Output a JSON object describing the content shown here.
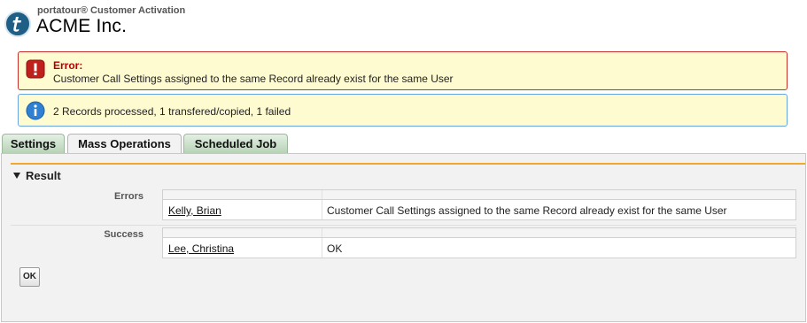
{
  "header": {
    "subtitle": "portatour® Customer Activation",
    "title": "ACME Inc."
  },
  "messages": {
    "error": {
      "title": "Error:",
      "text": "Customer Call Settings assigned to the same Record already exist for the same User"
    },
    "info": {
      "text": "2 Records processed, 1 transfered/copied, 1 failed"
    }
  },
  "tabs": [
    {
      "label": "Settings"
    },
    {
      "label": "Mass Operations"
    },
    {
      "label": "Scheduled Job"
    }
  ],
  "result": {
    "heading": "Result",
    "errors": {
      "label": "Errors",
      "rows": [
        {
          "name": "Kelly, Brian",
          "message": "Customer Call Settings assigned to the same Record already exist for the same User"
        }
      ]
    },
    "success": {
      "label": "Success",
      "rows": [
        {
          "name": "Lee, Christina",
          "message": "OK"
        }
      ]
    },
    "ok_label": "OK"
  },
  "colors": {
    "accent_line": "#f0a830",
    "error_border": "#c9302c",
    "info_border": "#6aa4dc",
    "message_bg": "#fffbd0",
    "tab_green": "#b7d2b7"
  },
  "icons": {
    "logo": "portatour-logo",
    "error": "error-icon",
    "info": "info-icon",
    "collapse": "triangle-down-icon"
  }
}
